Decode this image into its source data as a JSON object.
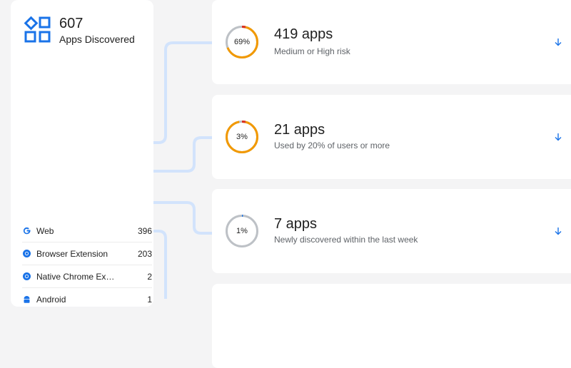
{
  "summary": {
    "count": "607",
    "label": "Apps Discovered",
    "icon": "apps-grid-icon"
  },
  "platforms": [
    {
      "name": "Web",
      "count": "396",
      "icon": "google-icon"
    },
    {
      "name": "Browser Extension",
      "count": "203",
      "icon": "chrome-icon"
    },
    {
      "name": "Native Chrome Ex…",
      "count": "2",
      "icon": "chrome-icon"
    },
    {
      "name": "Android",
      "count": "1",
      "icon": "android-icon"
    }
  ],
  "cards": [
    {
      "percent_label": "69%",
      "percent": 0.69,
      "title": "419 apps",
      "subtitle": "Medium or High risk"
    },
    {
      "percent_label": "3%",
      "percent": 0.97,
      "title": "21 apps",
      "subtitle": "Used by 20% of users or more"
    },
    {
      "percent_label": "1%",
      "percent": 0.01,
      "title": "7 apps",
      "subtitle": "Newly discovered within the last week"
    }
  ],
  "colors": {
    "accent_blue": "#1a73e8",
    "ring_orange": "#f29900",
    "ring_red": "#d93025",
    "ring_grey": "#bdc1c6",
    "connector": "#d2e3fc"
  }
}
